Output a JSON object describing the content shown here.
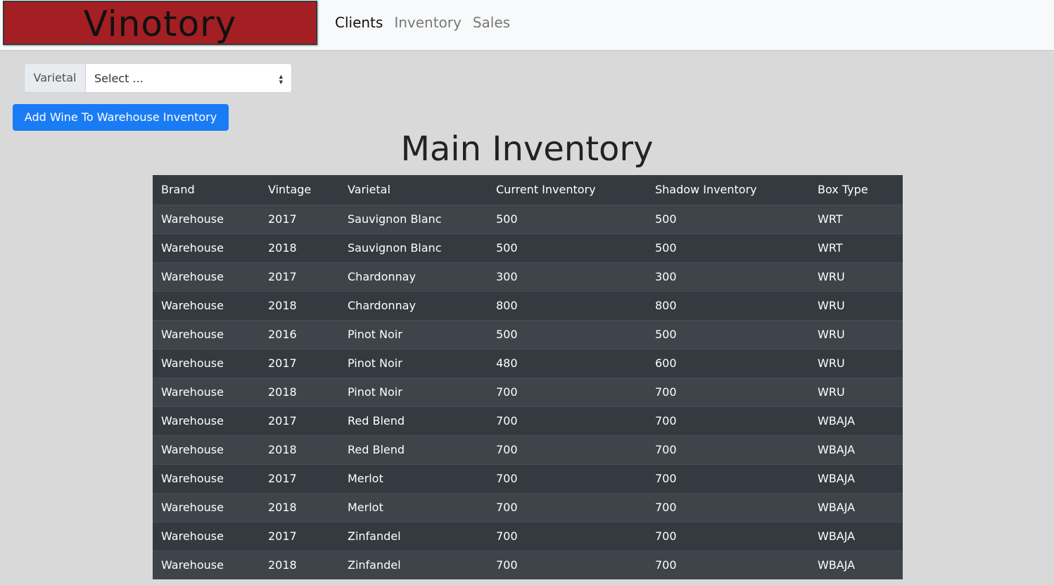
{
  "app": {
    "brand": "Vinotory"
  },
  "nav": {
    "items": [
      {
        "label": "Clients",
        "active": true
      },
      {
        "label": "Inventory",
        "active": false
      },
      {
        "label": "Sales",
        "active": false
      }
    ]
  },
  "filter": {
    "label": "Varietal",
    "select_value": "Select ..."
  },
  "actions": {
    "add_label": "Add Wine To Warehouse Inventory"
  },
  "main": {
    "title": "Main Inventory"
  },
  "table": {
    "columns": [
      "Brand",
      "Vintage",
      "Varietal",
      "Current Inventory",
      "Shadow Inventory",
      "Box Type"
    ],
    "rows": [
      [
        "Warehouse",
        "2017",
        "Sauvignon Blanc",
        "500",
        "500",
        "WRT"
      ],
      [
        "Warehouse",
        "2018",
        "Sauvignon Blanc",
        "500",
        "500",
        "WRT"
      ],
      [
        "Warehouse",
        "2017",
        "Chardonnay",
        "300",
        "300",
        "WRU"
      ],
      [
        "Warehouse",
        "2018",
        "Chardonnay",
        "800",
        "800",
        "WRU"
      ],
      [
        "Warehouse",
        "2016",
        "Pinot Noir",
        "500",
        "500",
        "WRU"
      ],
      [
        "Warehouse",
        "2017",
        "Pinot Noir",
        "480",
        "600",
        "WRU"
      ],
      [
        "Warehouse",
        "2018",
        "Pinot Noir",
        "700",
        "700",
        "WRU"
      ],
      [
        "Warehouse",
        "2017",
        "Red Blend",
        "700",
        "700",
        "WBAJA"
      ],
      [
        "Warehouse",
        "2018",
        "Red Blend",
        "700",
        "700",
        "WBAJA"
      ],
      [
        "Warehouse",
        "2017",
        "Merlot",
        "700",
        "700",
        "WBAJA"
      ],
      [
        "Warehouse",
        "2018",
        "Merlot",
        "700",
        "700",
        "WBAJA"
      ],
      [
        "Warehouse",
        "2017",
        "Zinfandel",
        "700",
        "700",
        "WBAJA"
      ],
      [
        "Warehouse",
        "2018",
        "Zinfandel",
        "700",
        "700",
        "WBAJA"
      ]
    ]
  },
  "colors": {
    "brand_bg": "#a31f24",
    "primary": "#1a7cf5",
    "table_dark": "#343a40",
    "table_stripe": "#3e444a"
  }
}
